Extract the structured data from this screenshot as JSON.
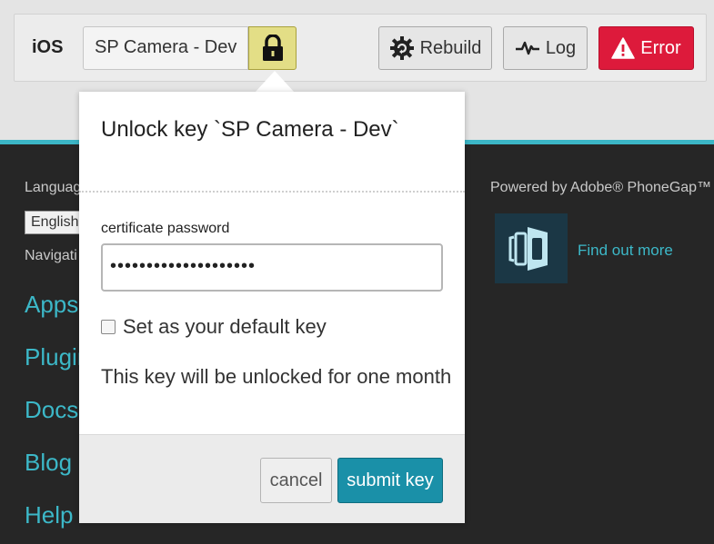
{
  "toolbar": {
    "platform": "iOS",
    "key_name": "SP Camera - Dev",
    "rebuild_label": "Rebuild",
    "log_label": "Log",
    "error_label": "Error"
  },
  "footer": {
    "language_label": "Languag",
    "language_value": "English",
    "navigation_label": "Navigati",
    "nav_links": [
      "Apps",
      "Plugin",
      "Docs",
      "Blog",
      "Help"
    ],
    "powered_by": "Powered by Adobe® PhoneGap™",
    "find_out_more": "Find out more"
  },
  "dialog": {
    "title": "Unlock key `SP Camera - Dev`",
    "password_label": "certificate password",
    "password_value": "••••••••••••••••••••",
    "default_key_label": "Set as your default key",
    "default_key_checked": false,
    "info_text": "This key will be unlocked for one month",
    "cancel_label": "cancel",
    "submit_label": "submit key"
  },
  "colors": {
    "teal": "#3cb8c8",
    "error_red": "#dd1a3b",
    "lock_yellow": "#e3de86",
    "submit_teal": "#1a90a8"
  },
  "icons": {
    "lock": "lock-icon",
    "rebuild": "gear-refresh-icon",
    "log": "pulse-icon",
    "error": "warning-icon"
  }
}
